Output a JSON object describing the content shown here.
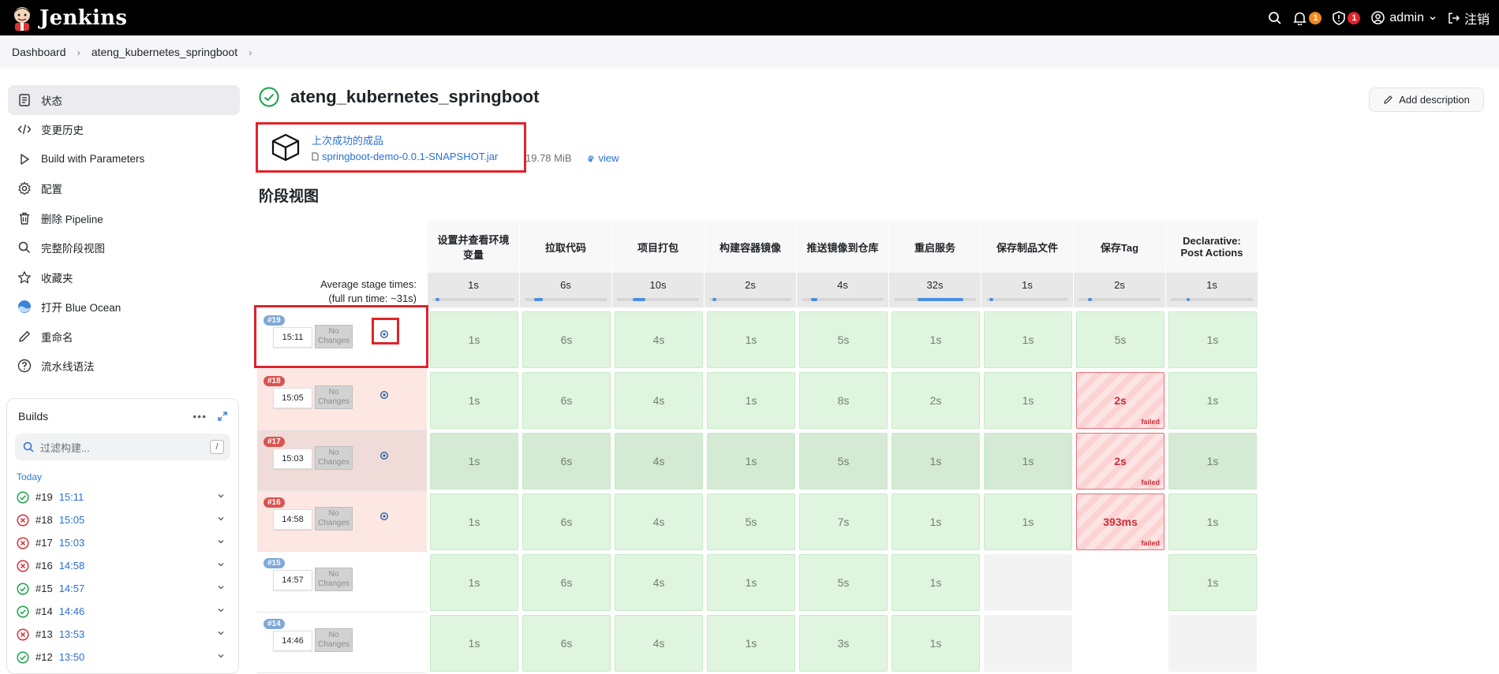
{
  "app": {
    "name": "Jenkins",
    "user": "admin",
    "logout": "注销",
    "notif_count": "1",
    "security_count": "1"
  },
  "breadcrumb": [
    "Dashboard",
    "ateng_kubernetes_springboot"
  ],
  "sidebar": {
    "items": [
      {
        "label": "状态",
        "icon": "status-icon"
      },
      {
        "label": "变更历史",
        "icon": "code-icon"
      },
      {
        "label": "Build with Parameters",
        "icon": "play-icon"
      },
      {
        "label": "配置",
        "icon": "gear-icon"
      },
      {
        "label": "删除 Pipeline",
        "icon": "trash-icon"
      },
      {
        "label": "完整阶段视图",
        "icon": "search-icon"
      },
      {
        "label": "收藏夹",
        "icon": "star-icon"
      },
      {
        "label": "打开 Blue Ocean",
        "icon": "blue-ocean-icon"
      },
      {
        "label": "重命名",
        "icon": "pencil-icon"
      },
      {
        "label": "流水线语法",
        "icon": "help-icon"
      }
    ]
  },
  "builds": {
    "title": "Builds",
    "filter_placeholder": "过滤构建...",
    "filter_shortcut": "/",
    "group": "Today",
    "items": [
      {
        "num": "#19",
        "time": "15:11",
        "status": "success"
      },
      {
        "num": "#18",
        "time": "15:05",
        "status": "failed"
      },
      {
        "num": "#17",
        "time": "15:03",
        "status": "failed"
      },
      {
        "num": "#16",
        "time": "14:58",
        "status": "failed"
      },
      {
        "num": "#15",
        "time": "14:57",
        "status": "success"
      },
      {
        "num": "#14",
        "time": "14:46",
        "status": "success"
      },
      {
        "num": "#13",
        "time": "13:53",
        "status": "failed"
      },
      {
        "num": "#12",
        "time": "13:50",
        "status": "success"
      }
    ]
  },
  "main": {
    "title": "ateng_kubernetes_springboot",
    "add_description": "Add description",
    "artifact_label": "上次成功的成品",
    "artifact_file": "springboot-demo-0.0.1-SNAPSHOT.jar",
    "artifact_size": "19.78 MiB",
    "artifact_view": "view",
    "stage_view_title": "阶段视图"
  },
  "stage_view": {
    "avg_label_1": "Average stage times:",
    "avg_label_2": "(full run time: ~31s)",
    "no_changes": "No Changes",
    "failed_label": "failed",
    "stages": [
      {
        "name": "设置并查看环境变量",
        "avg": "1s",
        "bar": 0.05
      },
      {
        "name": "拉取代码",
        "avg": "6s",
        "bar": 0.1
      },
      {
        "name": "项目打包",
        "avg": "10s",
        "bar": 0.15
      },
      {
        "name": "构建容器镜像",
        "avg": "2s",
        "bar": 0.05
      },
      {
        "name": "推送镜像到仓库",
        "avg": "4s",
        "bar": 0.08
      },
      {
        "name": "重启服务",
        "avg": "32s",
        "bar": 0.55
      },
      {
        "name": "保存制品文件",
        "avg": "1s",
        "bar": 0.05
      },
      {
        "name": "保存Tag",
        "avg": "2s",
        "bar": 0.05
      },
      {
        "name": "Declarative: Post Actions",
        "avg": "1s",
        "bar": 0.03
      }
    ],
    "runs": [
      {
        "num": "#19",
        "time": "15:11",
        "tag_color": "#7ea8d8",
        "row_bg": "#ffffff",
        "dark": false,
        "cells": [
          [
            "ok",
            "1s"
          ],
          [
            "ok",
            "6s"
          ],
          [
            "ok",
            "4s"
          ],
          [
            "ok",
            "1s"
          ],
          [
            "ok",
            "5s"
          ],
          [
            "ok",
            "1s"
          ],
          [
            "ok",
            "1s"
          ],
          [
            "ok",
            "5s"
          ],
          [
            "ok",
            "1s"
          ]
        ]
      },
      {
        "num": "#18",
        "time": "15:05",
        "tag_color": "#d9534f",
        "row_bg": "#fde7e3",
        "dark": false,
        "cells": [
          [
            "ok",
            "1s"
          ],
          [
            "ok",
            "6s"
          ],
          [
            "ok",
            "4s"
          ],
          [
            "ok",
            "1s"
          ],
          [
            "ok",
            "8s"
          ],
          [
            "ok",
            "2s"
          ],
          [
            "ok",
            "1s"
          ],
          [
            "fail",
            "2s"
          ],
          [
            "ok",
            "1s"
          ]
        ]
      },
      {
        "num": "#17",
        "time": "15:03",
        "tag_color": "#d9534f",
        "row_bg": "#efdcd8",
        "dark": true,
        "cells": [
          [
            "ok",
            "1s"
          ],
          [
            "ok",
            "6s"
          ],
          [
            "ok",
            "4s"
          ],
          [
            "ok",
            "1s"
          ],
          [
            "ok",
            "5s"
          ],
          [
            "ok",
            "1s"
          ],
          [
            "ok",
            "1s"
          ],
          [
            "fail",
            "2s"
          ],
          [
            "ok",
            "1s"
          ]
        ]
      },
      {
        "num": "#16",
        "time": "14:58",
        "tag_color": "#d9534f",
        "row_bg": "#fde7e3",
        "dark": false,
        "cells": [
          [
            "ok",
            "1s"
          ],
          [
            "ok",
            "6s"
          ],
          [
            "ok",
            "4s"
          ],
          [
            "ok",
            "5s"
          ],
          [
            "ok",
            "7s"
          ],
          [
            "ok",
            "1s"
          ],
          [
            "ok",
            "1s"
          ],
          [
            "fail",
            "393ms"
          ],
          [
            "ok",
            "1s"
          ]
        ]
      },
      {
        "num": "#15",
        "time": "14:57",
        "tag_color": "#7ea8d8",
        "row_bg": "#ffffff",
        "dark": false,
        "cells": [
          [
            "ok",
            "1s"
          ],
          [
            "ok",
            "6s"
          ],
          [
            "ok",
            "4s"
          ],
          [
            "ok",
            "1s"
          ],
          [
            "ok",
            "5s"
          ],
          [
            "ok",
            "1s"
          ],
          [
            "empty",
            ""
          ],
          [
            "blank",
            ""
          ],
          [
            "ok",
            "1s"
          ]
        ]
      },
      {
        "num": "#14",
        "time": "14:46",
        "tag_color": "#7ea8d8",
        "row_bg": "#ffffff",
        "dark": false,
        "cells": [
          [
            "ok",
            "1s"
          ],
          [
            "ok",
            "6s"
          ],
          [
            "ok",
            "4s"
          ],
          [
            "ok",
            "1s"
          ],
          [
            "ok",
            "3s"
          ],
          [
            "ok",
            "1s"
          ],
          [
            "empty",
            ""
          ],
          [
            "blank",
            ""
          ],
          [
            "empty",
            ""
          ]
        ]
      }
    ]
  }
}
